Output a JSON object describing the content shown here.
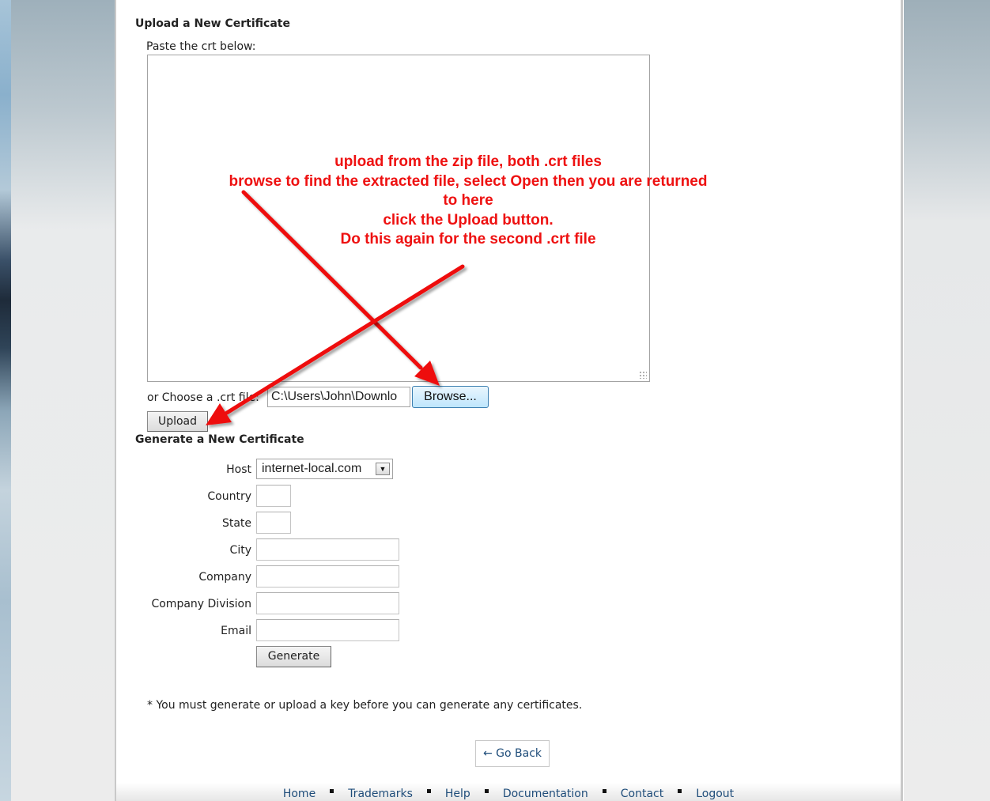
{
  "upload_section": {
    "title": "Upload a New Certificate",
    "paste_label": "Paste the crt below:",
    "choose_label": "or Choose a .crt file:",
    "file_value": "C:\\Users\\John\\Downlo",
    "browse_label": "Browse...",
    "upload_label": "Upload"
  },
  "annotation": {
    "lines": [
      "upload from the zip file, both .crt files",
      "browse to find the extracted file, select Open then you are returned",
      "to here",
      "click the Upload button.",
      "Do this again for the second .crt file"
    ],
    "color": "#ee1111"
  },
  "generate_section": {
    "title": "Generate a New Certificate",
    "host_label": "Host",
    "host_value": "internet-local.com",
    "country_label": "Country",
    "state_label": "State",
    "city_label": "City",
    "company_label": "Company",
    "division_label": "Company Division",
    "email_label": "Email",
    "generate_label": "Generate"
  },
  "footnote": "* You must generate or upload a key before you can generate any certificates.",
  "go_back_label": "← Go Back",
  "footer": {
    "links": [
      "Home",
      "Trademarks",
      "Help",
      "Documentation",
      "Contact",
      "Logout"
    ]
  },
  "icons": {
    "host_dropdown": "chevron-down-icon",
    "resize": "resize-grip-icon",
    "arrow": "red-arrow-annotation"
  }
}
